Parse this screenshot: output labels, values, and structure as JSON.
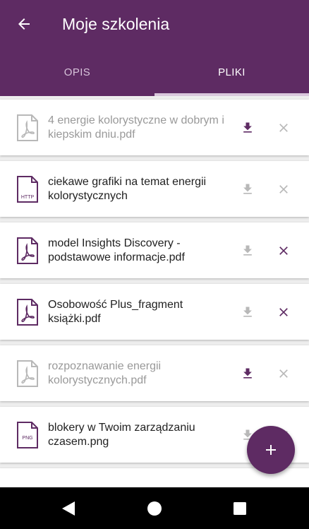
{
  "header": {
    "title": "Moje szkolenia"
  },
  "tabs": [
    {
      "label": "OPIS",
      "selected": false
    },
    {
      "label": "PLIKI",
      "selected": true
    }
  ],
  "files": [
    {
      "name": "4 energie kolorystyczne w dobrym i kiepskim dniu.pdf",
      "icon": "pdf-file-icon",
      "muted": true,
      "download_active": true,
      "remove_active": false
    },
    {
      "name": "ciekawe grafiki na temat energii kolorystycznych",
      "icon": "http-file-icon",
      "muted": false,
      "download_active": false,
      "remove_active": false
    },
    {
      "name": "model Insights Discovery - podstawowe informacje.pdf",
      "icon": "pdf-file-icon",
      "muted": false,
      "download_active": false,
      "remove_active": true
    },
    {
      "name": "Osobowość Plus_fragment książki.pdf",
      "icon": "pdf-file-icon",
      "muted": false,
      "download_active": false,
      "remove_active": true
    },
    {
      "name": "rozpoznawanie energii kolorystycznych.pdf",
      "icon": "pdf-file-icon",
      "muted": true,
      "download_active": true,
      "remove_active": false
    },
    {
      "name": "blokery w Twoim zarządzaniu czasem.png",
      "icon": "png-file-icon",
      "muted": false,
      "download_active": false,
      "remove_active": false
    }
  ],
  "file_icon_labels": {
    "http": "HTTP",
    "png": "PNG"
  },
  "colors": {
    "primary": "#5e2b63",
    "inactive": "#b8b8b8",
    "muted_text": "#999999",
    "text": "#212121"
  }
}
